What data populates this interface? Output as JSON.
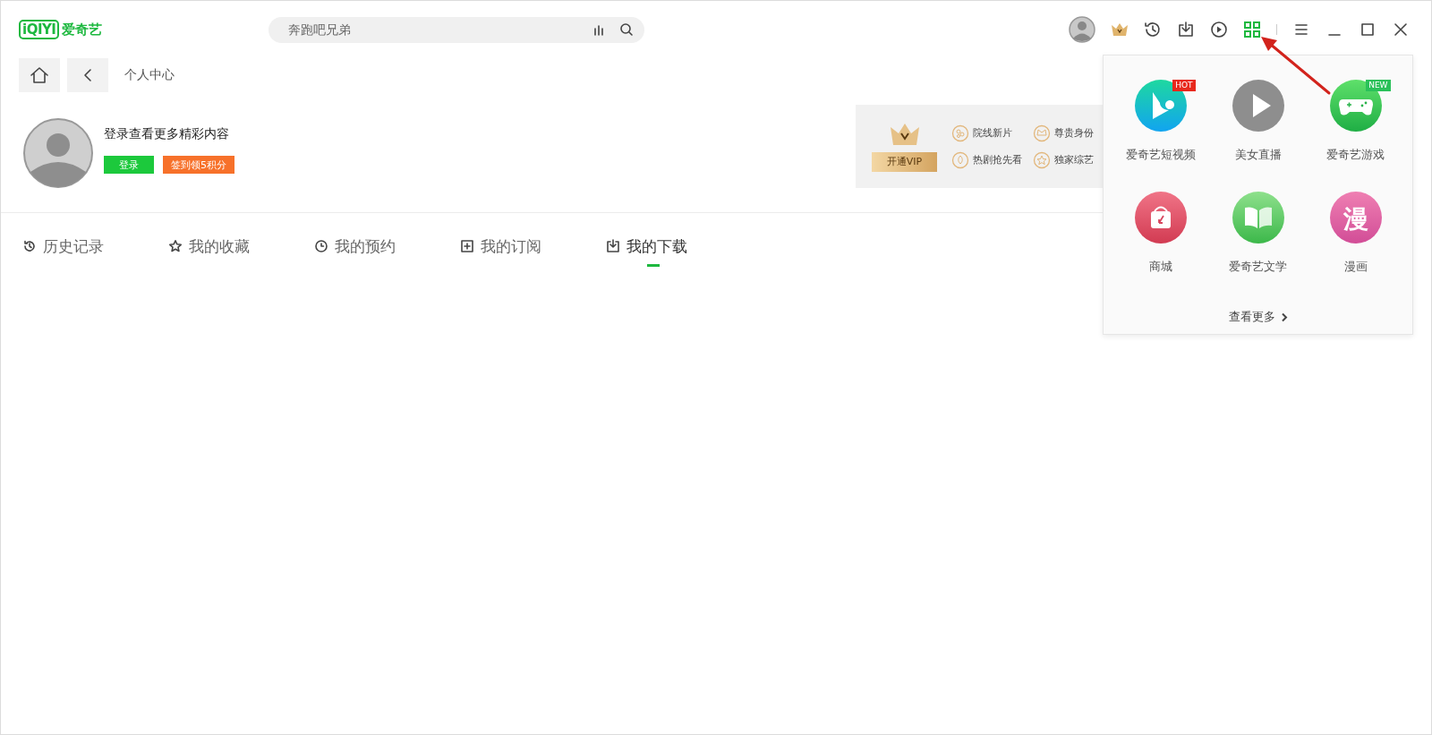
{
  "logo": {
    "mark": "iQIYI",
    "name": "爱奇艺"
  },
  "search": {
    "placeholder": "奔跑吧兄弟"
  },
  "breadcrumb": {
    "title": "个人中心"
  },
  "profile": {
    "prompt": "登录查看更多精彩内容",
    "login_button": "登录",
    "checkin_button": "签到领5积分"
  },
  "vip": {
    "button": "开通VIP",
    "perks": [
      "院线新片",
      "尊贵身份",
      "热剧抢先看",
      "独家综艺"
    ]
  },
  "tabs": [
    {
      "label": "历史记录",
      "selected": false
    },
    {
      "label": "我的收藏",
      "selected": false
    },
    {
      "label": "我的预约",
      "selected": false
    },
    {
      "label": "我的订阅",
      "selected": false
    },
    {
      "label": "我的下载",
      "selected": true
    }
  ],
  "apps_popup": {
    "apps": [
      {
        "label": "爱奇艺短视频",
        "badge": {
          "text": "HOT",
          "color": "#e8281c"
        }
      },
      {
        "label": "美女直播"
      },
      {
        "label": "爱奇艺游戏",
        "badge": {
          "text": "NEW",
          "color": "#2bc15a"
        }
      },
      {
        "label": "商城"
      },
      {
        "label": "爱奇艺文学"
      },
      {
        "label": "漫画",
        "icon_text": "漫"
      }
    ],
    "more": "查看更多"
  }
}
